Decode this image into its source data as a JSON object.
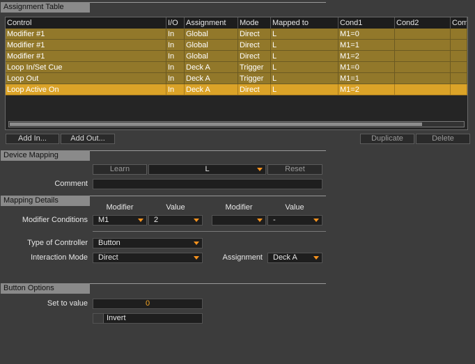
{
  "assignment_table": {
    "header": "Assignment Table",
    "columns": [
      "Control",
      "I/O",
      "Assignment",
      "Mode",
      "Mapped to",
      "Cond1",
      "Cond2",
      "Com"
    ],
    "rows": [
      {
        "control": "Modifier #1",
        "io": "In",
        "assignment": "Global",
        "mode": "Direct",
        "mapped": "L",
        "cond1": "M1=0",
        "cond2": "",
        "com": "",
        "selected": false
      },
      {
        "control": "Modifier #1",
        "io": "In",
        "assignment": "Global",
        "mode": "Direct",
        "mapped": "L",
        "cond1": "M1=1",
        "cond2": "",
        "com": "",
        "selected": false
      },
      {
        "control": "Modifier #1",
        "io": "In",
        "assignment": "Global",
        "mode": "Direct",
        "mapped": "L",
        "cond1": "M1=2",
        "cond2": "",
        "com": "",
        "selected": false
      },
      {
        "control": "Loop In/Set Cue",
        "io": "In",
        "assignment": "Deck A",
        "mode": "Trigger",
        "mapped": "L",
        "cond1": "M1=0",
        "cond2": "",
        "com": "",
        "selected": false
      },
      {
        "control": "Loop Out",
        "io": "In",
        "assignment": "Deck A",
        "mode": "Trigger",
        "mapped": "L",
        "cond1": "M1=1",
        "cond2": "",
        "com": "",
        "selected": false
      },
      {
        "control": "Loop Active On",
        "io": "In",
        "assignment": "Deck A",
        "mode": "Direct",
        "mapped": "L",
        "cond1": "M1=2",
        "cond2": "",
        "com": "",
        "selected": true
      }
    ],
    "buttons": {
      "add_in": "Add In...",
      "add_out": "Add Out...",
      "duplicate": "Duplicate",
      "delete": "Delete"
    }
  },
  "device_mapping": {
    "header": "Device Mapping",
    "learn": "Learn",
    "mapped_value": "L",
    "reset": "Reset",
    "comment_label": "Comment",
    "comment_value": ""
  },
  "mapping_details": {
    "header": "Mapping Details",
    "modifier_col": "Modifier",
    "value_col": "Value",
    "modifier_col2": "Modifier",
    "value_col2": "Value",
    "modifier_conditions_label": "Modifier Conditions",
    "mod1": "M1",
    "val1": "2",
    "mod2": "",
    "val2": "-",
    "type_label": "Type of Controller",
    "type_value": "Button",
    "interaction_label": "Interaction Mode",
    "interaction_value": "Direct",
    "assignment_label": "Assignment",
    "assignment_value": "Deck A"
  },
  "button_options": {
    "header": "Button Options",
    "set_to_value_label": "Set to value",
    "set_to_value": "0",
    "invert_label": "Invert"
  },
  "colors": {
    "row": "#92782a",
    "row_selected": "#dba328",
    "accent": "#f5921e"
  }
}
